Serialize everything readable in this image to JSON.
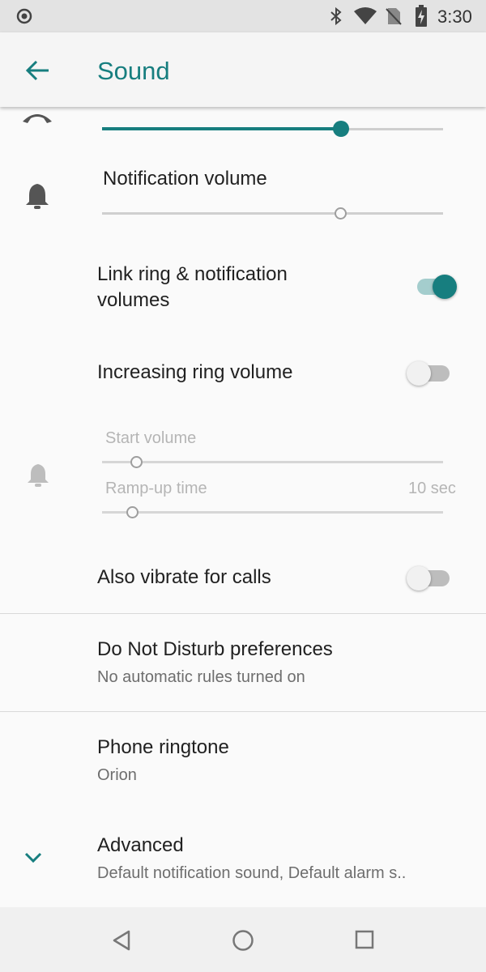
{
  "status_bar": {
    "time": "3:30",
    "icons": [
      "location-icon",
      "bluetooth-icon",
      "wifi-icon",
      "no-sim-icon",
      "battery-charging-icon"
    ]
  },
  "app_bar": {
    "back_icon": "arrow-back-icon",
    "title": "Sound"
  },
  "ring_volume": {
    "icon": "phone-ring-icon",
    "level": 0.7
  },
  "notification_volume": {
    "icon": "bell-icon",
    "label": "Notification volume",
    "level": 0.7
  },
  "link_volumes": {
    "label": "Link ring & notification volumes",
    "checked": true
  },
  "increasing_ring": {
    "label": "Increasing ring volume",
    "checked": false
  },
  "ramp_settings": {
    "icon": "bell-ring-icon",
    "start_volume_label": "Start volume",
    "start_volume_level": 0.1,
    "ramp_time_label": "Ramp-up time",
    "ramp_time_value": "10 sec",
    "ramp_time_level": 0.09
  },
  "vibrate_calls": {
    "label": "Also vibrate for calls",
    "checked": false
  },
  "dnd": {
    "title": "Do Not Disturb preferences",
    "subtitle": "No automatic rules turned on"
  },
  "ringtone": {
    "title": "Phone ringtone",
    "subtitle": "Orion"
  },
  "advanced": {
    "icon": "chevron-down-icon",
    "title": "Advanced",
    "subtitle": "Default notification sound, Default alarm s.."
  },
  "nav_bar": {
    "icons": [
      "back-triangle-icon",
      "home-circle-icon",
      "recents-square-icon"
    ]
  },
  "colors": {
    "accent": "#177e7f",
    "status_bar": "#e3e3e3",
    "background": "#fafafa"
  }
}
